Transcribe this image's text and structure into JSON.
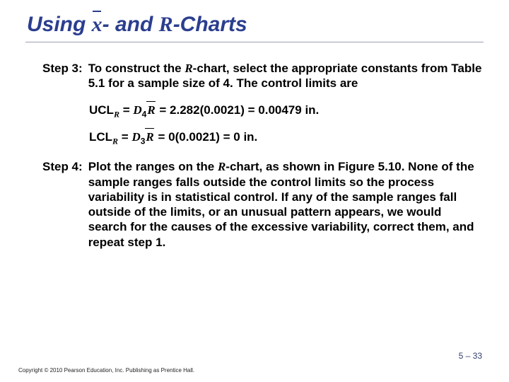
{
  "title": {
    "pre": "Using ",
    "xbar": "x",
    "mid": "- and ",
    "R": "R",
    "post": "-Charts"
  },
  "step3": {
    "label": "Step 3:",
    "text_pre": "To construct the ",
    "R": "R",
    "text_post": "-chart, select the appropriate constants from Table 5.1 for a sample size of 4. The control limits are"
  },
  "eqn1": {
    "name": "UCL",
    "nameSub": "R",
    "eq1": " = ",
    "D": "D",
    "Dsub": "4",
    "Rbar": "R",
    "eq2": " = ",
    "rhs": " 2.282(0.0021) = 0.00479 in."
  },
  "eqn2": {
    "name": "LCL",
    "nameSub": "R",
    "eq1": " = ",
    "D": "D",
    "Dsub": "3",
    "Rbar": "R",
    "eq2": " = ",
    "rhs": " 0(0.0021) = 0 in."
  },
  "step4": {
    "label": "Step 4:",
    "text_pre": "Plot the ranges on the ",
    "R": "R",
    "text_post": "-chart, as shown in Figure 5.10. None of the sample ranges falls outside the control limits so the process variability is in statistical control. If any of the sample ranges fall outside of the limits, or an unusual pattern appears, we would search for the causes of the excessive variability, correct them, and repeat step 1."
  },
  "pagenum": "5 – 33",
  "copyright": "Copyright © 2010 Pearson Education, Inc. Publishing as Prentice Hall."
}
